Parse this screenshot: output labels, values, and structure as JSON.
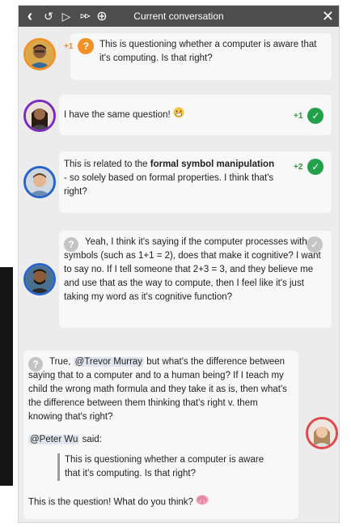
{
  "header": {
    "title": "Current conversation",
    "back_icon": "‹",
    "rewind_icon": "↺",
    "play_icon": "▷",
    "fast_forward_icon": "⊳⊳",
    "target_icon": "⊕",
    "close_icon": "✕"
  },
  "messages": [
    {
      "author": "",
      "vote_count": "+1",
      "vote_status": "question",
      "text": "This is questioning whether a computer is aware that it's computing. Is that right?"
    },
    {
      "author": "",
      "vote_count": "+1",
      "vote_status": "agree",
      "text": "I have the same question!"
    },
    {
      "author": "",
      "vote_count": "+2",
      "vote_status": "agree",
      "text_before": "This is related to the ",
      "text_bold": "formal symbol manipulation",
      "text_after": " - so solely based on formal properties. I think that's right?"
    },
    {
      "author": "",
      "vote_status": "pending",
      "text": "Yeah, I think it's saying if the computer processes with symbols (such as 1+1 = 2), does that make it cognitive? I want to say no. If I tell someone that 2+3 = 3, and they believe me and use that as the way to compute, then I feel like it's just taking my word as it's cognitive function?"
    },
    {
      "author": "",
      "text_pre_mention": "True, ",
      "mention": "@Trevor Murray",
      "text_post_mention": " but what's the difference between saying that to a computer and to a human being? If I teach my child the wrong math formula and they take it as is, then what's the difference between them thinking that's right v. them knowing that's right?",
      "quote_mention": "@Peter Wu",
      "quote_said": "said:",
      "quote_text": "This is questioning whether a computer is aware that it's computing. Is that right?",
      "closing": "This is the question! What do you think?"
    }
  ],
  "colors": {
    "header_bg": "#4d4d4d",
    "panel_bg": "#ececec",
    "card_bg": "#f8f8f8",
    "agree_green": "#22a04a",
    "question_orange": "#f39124",
    "avatar_blue": "#2962c8",
    "avatar_orange": "#f39124",
    "avatar_purple": "#7b2cbf",
    "avatar_red": "#e0474f"
  }
}
